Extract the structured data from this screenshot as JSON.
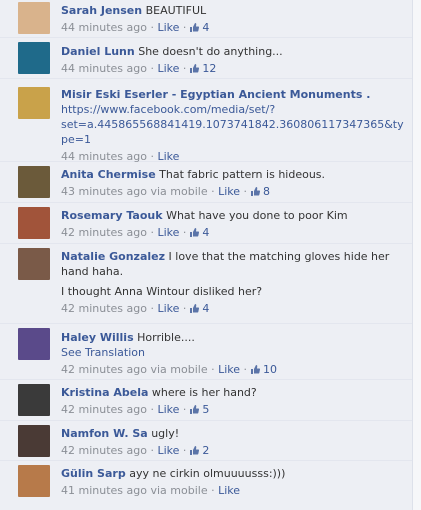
{
  "comments": [
    {
      "name": "Sarah Jensen",
      "text": "BEAUTIFUL",
      "time": "44 minutes ago",
      "via": "",
      "like": "Like",
      "likes": "4",
      "avatar_color": "#d9b38c"
    },
    {
      "name": "Daniel Lunn",
      "text": "She doesn't do anything...",
      "time": "44 minutes ago",
      "via": "",
      "like": "Like",
      "likes": "12",
      "avatar_color": "#1f6a8a"
    },
    {
      "name": "Misir Eski Eserler - Egyptian Ancient Monuments .",
      "link_lines": [
        "https://www.facebook.com/media/set/?",
        "set=a.445865568841419.1073741842.360806117347365&ty",
        "pe=1"
      ],
      "time": "44 minutes ago",
      "via": "",
      "like": "Like",
      "likes": "",
      "avatar_color": "#c9a24a"
    },
    {
      "name": "Anita Chermise",
      "text": "That fabric pattern is hideous.",
      "time": "43 minutes ago",
      "via": "via mobile",
      "like": "Like",
      "likes": "8",
      "avatar_color": "#6b5a3a"
    },
    {
      "name": "Rosemary Taouk",
      "text": "What have you done to poor Kim",
      "time": "42 minutes ago",
      "via": "",
      "like": "Like",
      "likes": "4",
      "avatar_color": "#a1543a"
    },
    {
      "name": "Natalie Gonzalez",
      "text_lines": [
        "I love that the matching gloves hide her",
        "hand haha.",
        "",
        "I thought Anna Wintour disliked her?"
      ],
      "time": "42 minutes ago",
      "via": "",
      "like": "Like",
      "likes": "4",
      "avatar_color": "#7a5a48"
    },
    {
      "name": "Haley Willis",
      "text": "Horrible....",
      "translation": "See Translation",
      "time": "42 minutes ago",
      "via": "via mobile",
      "like": "Like",
      "likes": "10",
      "avatar_color": "#5a4a8a"
    },
    {
      "name": "Kristina Abela",
      "text": "where is her hand?",
      "time": "42 minutes ago",
      "via": "",
      "like": "Like",
      "likes": "5",
      "avatar_color": "#3a3a3a"
    },
    {
      "name": "Namfon W. Sa",
      "text": "ugly!",
      "time": "42 minutes ago",
      "via": "",
      "like": "Like",
      "likes": "2",
      "avatar_color": "#4a3a35"
    },
    {
      "name": "Gülin Sarp",
      "text": "ayy ne cirkin olmuuuusss:)))",
      "time": "41 minutes ago",
      "via": "via mobile",
      "like": "Like",
      "likes": "",
      "avatar_color": "#b77a4a"
    }
  ],
  "ui": {
    "separator": "·"
  }
}
